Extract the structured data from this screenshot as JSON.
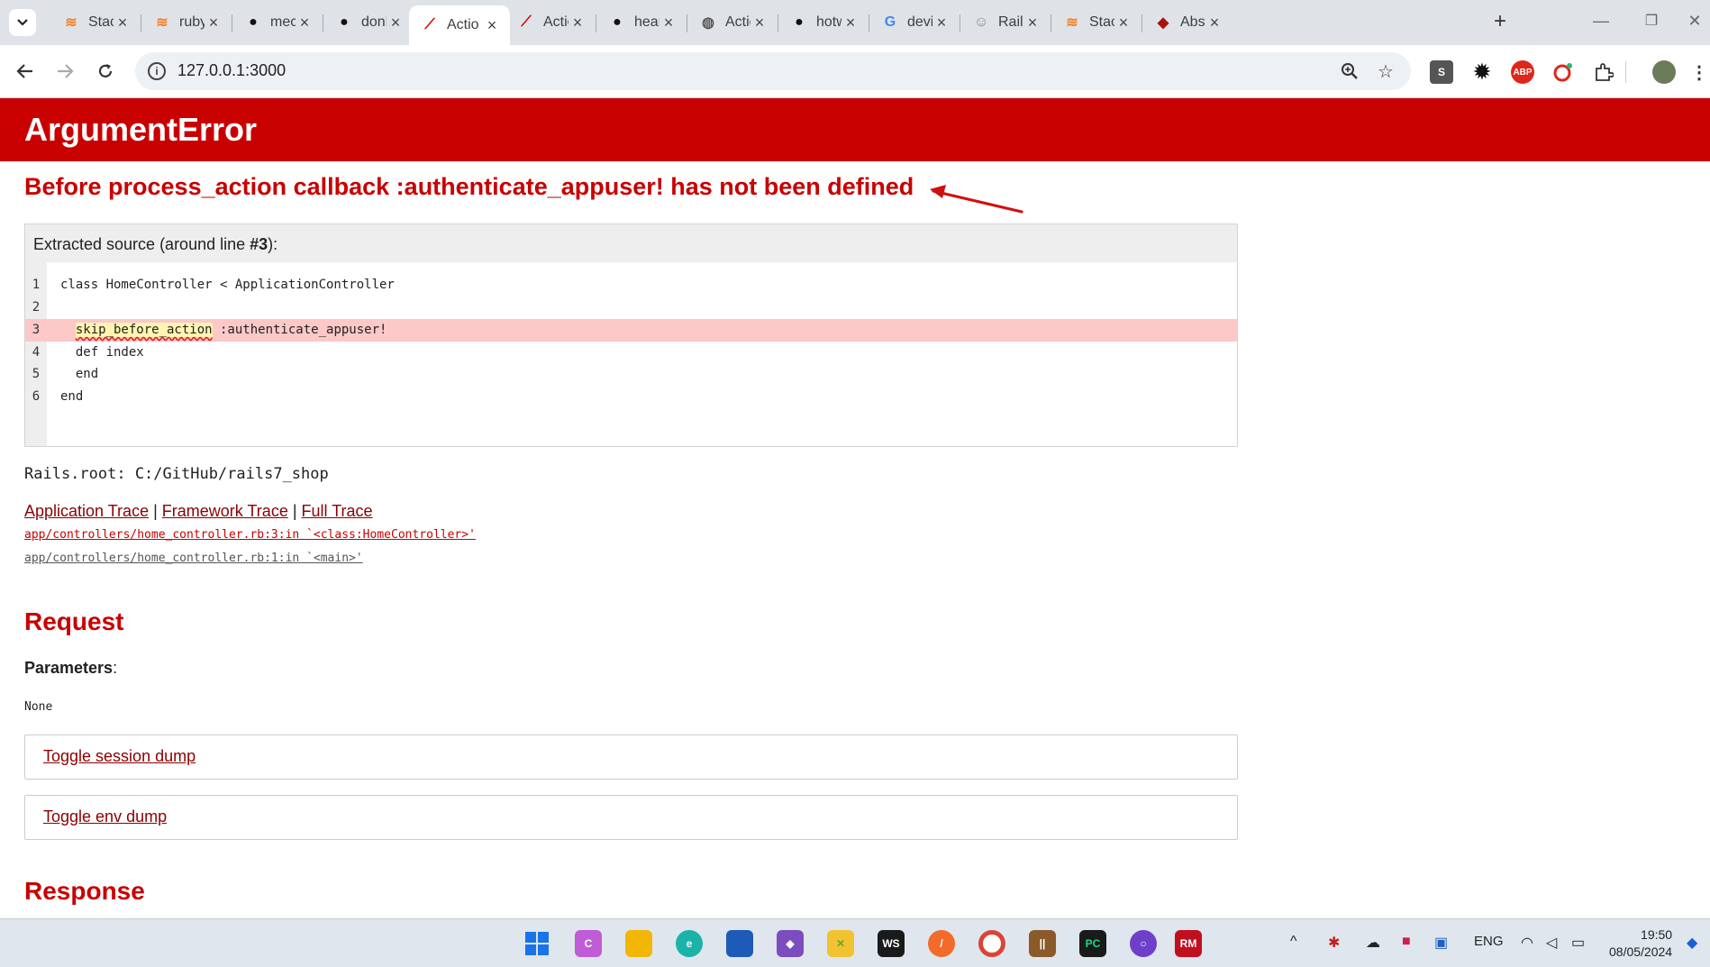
{
  "browser": {
    "tabs": [
      {
        "title": "Stack",
        "icon": "stackoverflow-icon",
        "color": "#f48024"
      },
      {
        "title": "ruby",
        "icon": "stackoverflow-icon",
        "color": "#f48024"
      },
      {
        "title": "mech",
        "icon": "github-icon",
        "color": "#111111"
      },
      {
        "title": "donh",
        "icon": "github-icon",
        "color": "#111111"
      },
      {
        "title": "Actio",
        "icon": "rails-icon",
        "color": "#cc0000",
        "active": true
      },
      {
        "title": "Actio",
        "icon": "rails-icon",
        "color": "#cc0000"
      },
      {
        "title": "heart",
        "icon": "github-icon",
        "color": "#111111"
      },
      {
        "title": "Actio",
        "icon": "globe-icon",
        "color": "#555555"
      },
      {
        "title": "hotw",
        "icon": "github-icon",
        "color": "#111111"
      },
      {
        "title": "devis",
        "icon": "google-icon",
        "color": "#4285f4"
      },
      {
        "title": "Rails",
        "icon": "avatar-icon",
        "color": "#888888"
      },
      {
        "title": "Stack",
        "icon": "stackoverflow-icon",
        "color": "#f48024"
      },
      {
        "title": "Abstr",
        "icon": "ruby-icon",
        "color": "#aa1111"
      }
    ],
    "url": "127.0.0.1:3000"
  },
  "page": {
    "error_class": "ArgumentError",
    "error_message": "Before process_action callback :authenticate_appuser! has not been defined",
    "source_header_prefix": "Extracted source (around line ",
    "source_header_line": "#3",
    "source_header_suffix": "):",
    "source_lines": [
      {
        "num": "1",
        "text": "class HomeController < ApplicationController"
      },
      {
        "num": "2",
        "text": ""
      },
      {
        "num": "3",
        "text": "  skip_before_action :authenticate_appuser!",
        "highlight": true
      },
      {
        "num": "4",
        "text": "  def index"
      },
      {
        "num": "5",
        "text": "  end"
      },
      {
        "num": "6",
        "text": "end"
      }
    ],
    "squiggle_word": "skip_before_action",
    "squiggle_rest": " :authenticate_appuser!",
    "rails_root": "Rails.root: C:/GitHub/rails7_shop",
    "trace_links": [
      "Application Trace",
      "Framework Trace",
      "Full Trace"
    ],
    "trace_sep": "|",
    "trace_lines": [
      {
        "text": "app/controllers/home_controller.rb:3:in `<class:HomeController>'",
        "color": "#c80000"
      },
      {
        "text": "app/controllers/home_controller.rb:1:in `<main>'",
        "color": "#555555"
      }
    ],
    "request_heading": "Request",
    "parameters_label": "Parameters",
    "parameters_colon": ":",
    "parameters_value": "None",
    "toggle_session": "Toggle session dump",
    "toggle_env": "Toggle env dump",
    "response_heading": "Response"
  },
  "taskbar": {
    "language": "ENG",
    "time": "19:50",
    "date": "08/05/2024"
  },
  "colors": {
    "error_red": "#c80000",
    "link_dark_red": "#8b0000",
    "highlight_line": "#fcc8c8"
  }
}
